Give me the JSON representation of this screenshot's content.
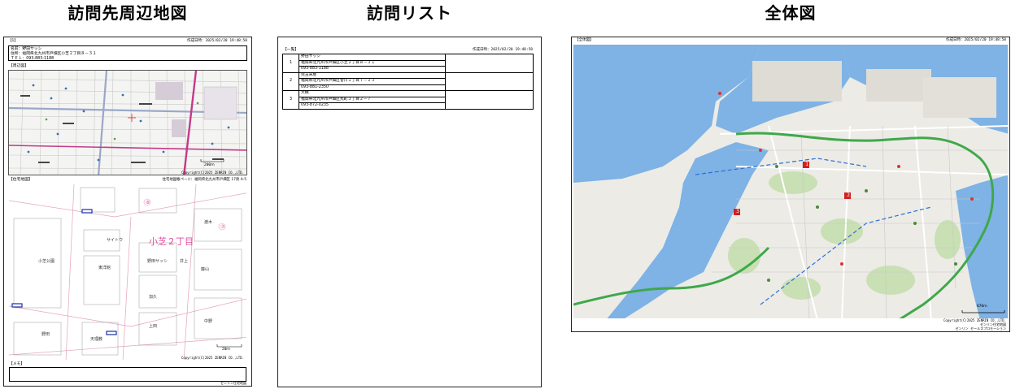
{
  "titles": {
    "left": "訪問先周辺地図",
    "middle": "訪問リスト",
    "right": "全体図"
  },
  "sheet1": {
    "page_no": "【1】",
    "created": "作成日時：2025/02/20 19:48:58",
    "name_line": "名前：野田サッシ",
    "address_line": "住所：福岡県北九州市戸畑区小芝２丁目８－３１",
    "tel_line": "ＴＥＬ：093-883-1188",
    "area_section": "【周辺図】",
    "area_copyright": "Copyright(C)2025 ZENRIN CO.,LTD.",
    "area_scale": "200ｍ",
    "house_section": "【住宅地図】",
    "house_page": "住宅地図帳ページ：福岡県北九州市戸畑区 17頁 A-5",
    "district": "小芝２丁目",
    "house_copyright": "Copyright(C)2025 ZENRIN CO.,LTD.",
    "house_scale": "20ｍ",
    "memo_section": "【メモ】",
    "footer": "ゼンリン住宅地図"
  },
  "sheet2": {
    "section": "【一覧】",
    "created": "作成日時：2025/02/20 19:48:58",
    "rows": [
      {
        "no": "1",
        "name": "野田サッシ",
        "address": "福岡県北九州市戸畑区小芝２丁目８－３１",
        "tel": "093-883-1188"
      },
      {
        "no": "2",
        "name": "児玉米屋",
        "address": "福岡県北九州市戸畑区菅川１丁目７－２３",
        "tel": "093-881-2350"
      },
      {
        "no": "3",
        "name": "大橋",
        "address": "福岡県北九州市戸畑区丸町３丁目２－７",
        "tel": "093-872-0235"
      }
    ]
  },
  "sheet3": {
    "section": "【全体図】",
    "created": "作成日時：2025/02/20 19:48:58",
    "copyright": "Copyright(C)2025 ZENRIN CO.,LTD.",
    "copyright2": "ゼンリン住宅地図",
    "scale": "870ｍ",
    "footer": "ゼンリン セールスプロモーション",
    "markers": [
      "1",
      "2",
      "3"
    ]
  }
}
